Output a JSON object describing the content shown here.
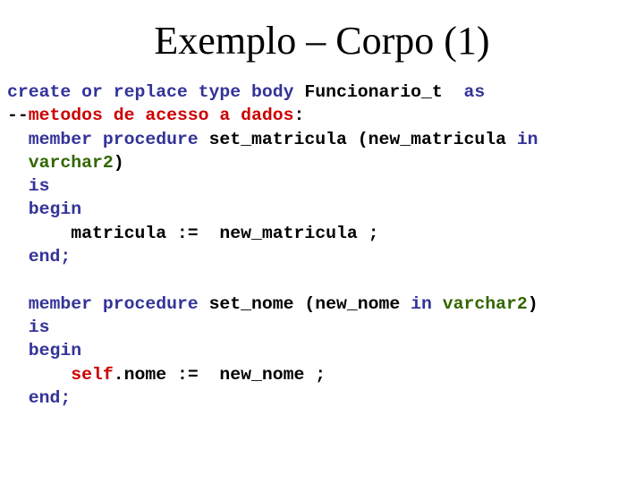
{
  "slide": {
    "title": "Exemplo – Corpo (1)",
    "code_lines": [
      [
        {
          "t": "create or replace type body ",
          "c": "kw"
        },
        {
          "t": "Funcionario_t  ",
          "c": "pl"
        },
        {
          "t": "as",
          "c": "kw"
        }
      ],
      [
        {
          "t": "--",
          "c": "pl"
        },
        {
          "t": "metodos de acesso a dados",
          "c": "cm"
        },
        {
          "t": ":",
          "c": "pl"
        }
      ],
      [
        {
          "t": "  ",
          "c": "pl"
        },
        {
          "t": "member procedure ",
          "c": "kw"
        },
        {
          "t": "set_matricula (new_matricula ",
          "c": "pl"
        },
        {
          "t": "in",
          "c": "kw"
        }
      ],
      [
        {
          "t": "  ",
          "c": "pl"
        },
        {
          "t": "varchar2",
          "c": "ty"
        },
        {
          "t": ")",
          "c": "pl"
        }
      ],
      [
        {
          "t": "  ",
          "c": "pl"
        },
        {
          "t": "is",
          "c": "kw"
        }
      ],
      [
        {
          "t": "  ",
          "c": "pl"
        },
        {
          "t": "begin",
          "c": "kw"
        }
      ],
      [
        {
          "t": "      matricula :=  new_matricula ;",
          "c": "pl"
        }
      ],
      [
        {
          "t": "  ",
          "c": "pl"
        },
        {
          "t": "end;",
          "c": "kw"
        }
      ],
      [],
      [
        {
          "t": "  ",
          "c": "pl"
        },
        {
          "t": "member procedure ",
          "c": "kw"
        },
        {
          "t": "set_nome (new_nome ",
          "c": "pl"
        },
        {
          "t": "in ",
          "c": "kw"
        },
        {
          "t": "varchar2",
          "c": "ty"
        },
        {
          "t": ")",
          "c": "pl"
        }
      ],
      [
        {
          "t": "  ",
          "c": "pl"
        },
        {
          "t": "is",
          "c": "kw"
        }
      ],
      [
        {
          "t": "  ",
          "c": "pl"
        },
        {
          "t": "begin",
          "c": "kw"
        }
      ],
      [
        {
          "t": "      ",
          "c": "pl"
        },
        {
          "t": "self",
          "c": "sf"
        },
        {
          "t": ".nome :=  new_nome ;",
          "c": "pl"
        }
      ],
      [
        {
          "t": "  ",
          "c": "pl"
        },
        {
          "t": "end;",
          "c": "kw"
        }
      ]
    ]
  },
  "colors": {
    "keyword": "#333399",
    "type": "#336600",
    "comment": "#cc0000",
    "self": "#cc0000",
    "plain": "#000000"
  }
}
